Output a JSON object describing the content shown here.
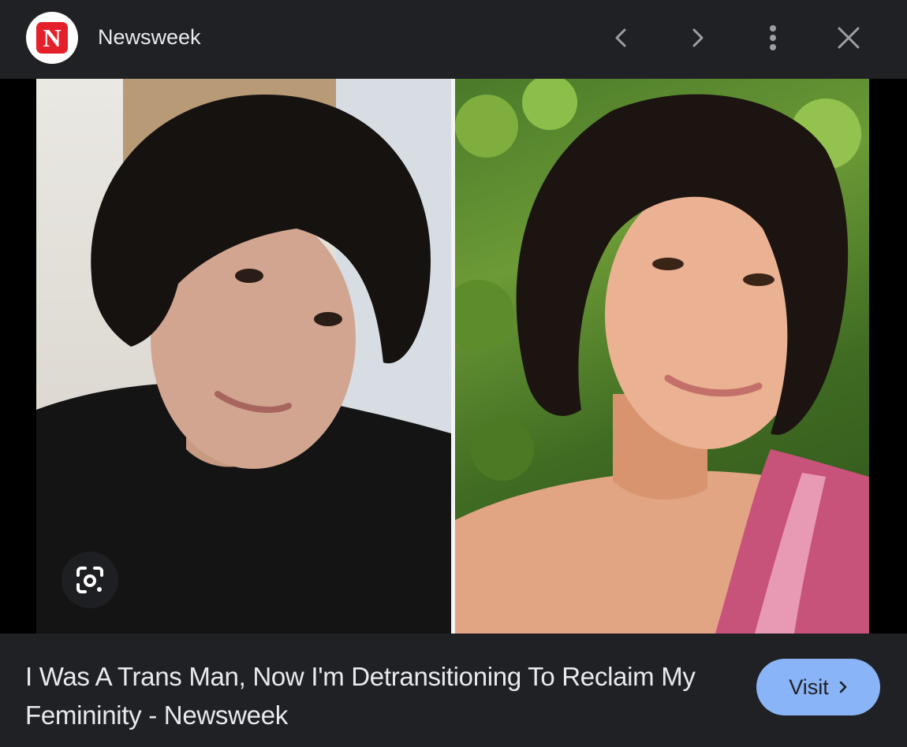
{
  "header": {
    "source_logo_letter": "N",
    "source_name": "Newsweek"
  },
  "colors": {
    "background": "#202124",
    "text": "#e8eaed",
    "icon": "#9aa0a6",
    "accent_button": "#8ab4f8",
    "logo_red": "#e4212b"
  },
  "icons": {
    "prev": "chevron-left-icon",
    "next": "chevron-right-icon",
    "more": "more-vert-icon",
    "close": "close-icon",
    "lens": "google-lens-icon"
  },
  "footer": {
    "caption": "I Was A Trans Man, Now I'm Detransitioning To Reclaim My Femininity - Newsweek",
    "visit_label": "Visit"
  }
}
